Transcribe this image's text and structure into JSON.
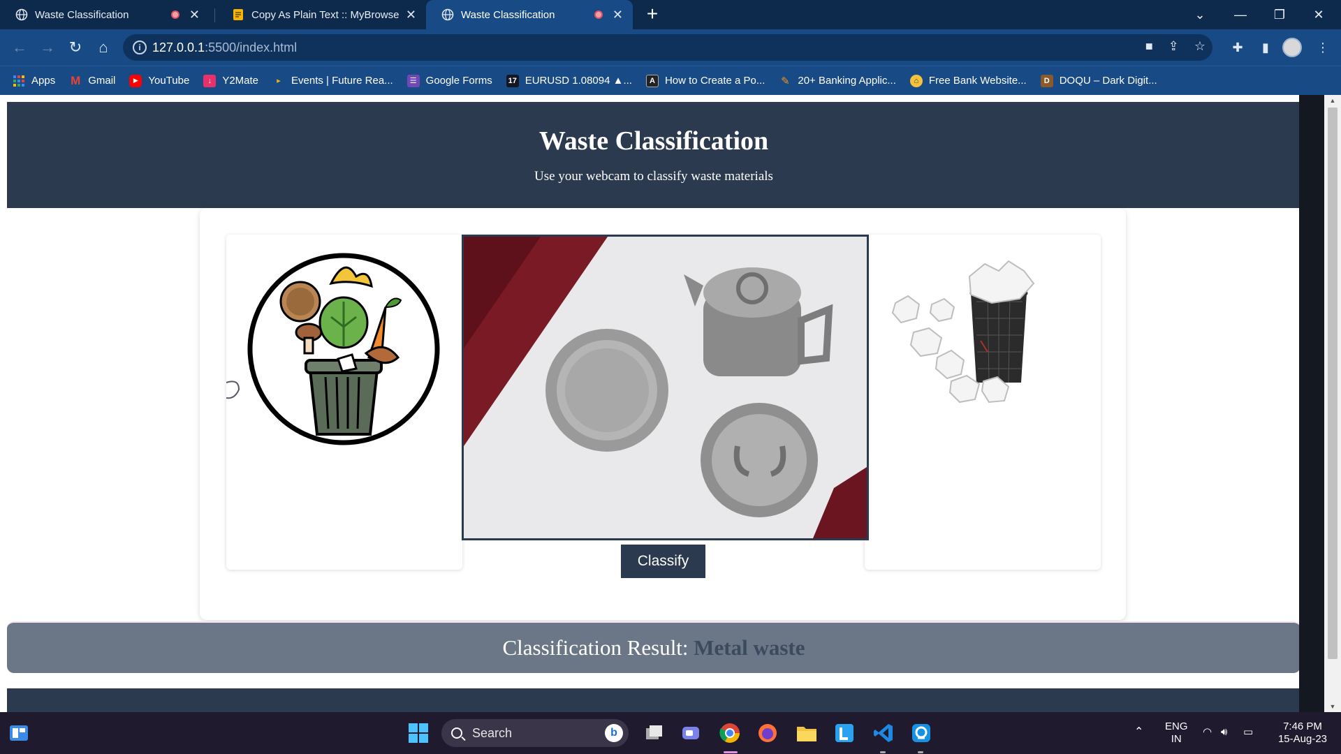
{
  "browser": {
    "tabs": [
      {
        "title": "Waste Classification",
        "recording": true,
        "active": false
      },
      {
        "title": "Copy As Plain Text :: MyBrowserA",
        "recording": false,
        "active": false
      },
      {
        "title": "Waste Classification",
        "recording": true,
        "active": true
      }
    ],
    "url_host": "127.0.0.1",
    "url_rest": ":5500/index.html",
    "bookmarks": [
      {
        "label": "Apps",
        "icon": "apps-grid-icon",
        "color": "#4285f4"
      },
      {
        "label": "Gmail",
        "icon": "gmail-icon",
        "color": "#ea4335"
      },
      {
        "label": "YouTube",
        "icon": "youtube-icon",
        "color": "#ff0000"
      },
      {
        "label": "Y2Mate",
        "icon": "y2mate-icon",
        "color": "#e8316b"
      },
      {
        "label": "Events | Future Rea...",
        "icon": "play-arrow-icon",
        "color": "#f4b400"
      },
      {
        "label": "Google Forms",
        "icon": "google-forms-icon",
        "color": "#7248b9"
      },
      {
        "label": "EURUSD 1.08094 ▲...",
        "icon": "tradingview-icon",
        "color": "#131722"
      },
      {
        "label": "How to Create a Po...",
        "icon": "angular-icon",
        "color": "#222222"
      },
      {
        "label": "20+ Banking Applic...",
        "icon": "pencil-icon",
        "color": "#f7931e"
      },
      {
        "label": "Free Bank Website...",
        "icon": "bank-icon",
        "color": "#f6c23e"
      },
      {
        "label": "DOQU – Dark Digit...",
        "icon": "doqu-icon",
        "color": "#8a5a2b"
      }
    ]
  },
  "page": {
    "title": "Waste Classification",
    "subtitle": "Use your webcam to classify waste materials",
    "classify_label": "Classify",
    "result_label": "Classification Result:",
    "result_value": "Metal waste"
  },
  "taskbar": {
    "search_placeholder": "Search",
    "lang_top": "ENG",
    "lang_bottom": "IN",
    "time": "7:46 PM",
    "date": "15-Aug-23"
  },
  "colors": {
    "header_bg": "#2b3a4e",
    "result_bg": "#6b7787",
    "result_value": "#3b4a5e",
    "browser_frame": "#184a85"
  }
}
